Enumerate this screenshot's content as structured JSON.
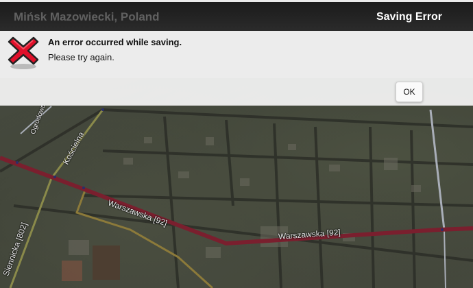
{
  "header": {
    "location": "Mińsk Mazowiecki, Poland",
    "dialog_title": "Saving Error"
  },
  "dialog": {
    "icon": "error-x-icon",
    "heading": "An error occurred while saving.",
    "message": "Please try again.",
    "ok_label": "OK"
  },
  "map": {
    "road_labels": [
      "Ogrodowa",
      "Kościelna",
      "Warszawska [92]",
      "Warszawska [92]",
      "Siennicka [802]"
    ],
    "colors": {
      "main_road": "#7a1f2e",
      "secondary_road": "#8a8a4a",
      "local_road": "#8c7a3a",
      "minor_road": "#a9aeb8"
    }
  }
}
